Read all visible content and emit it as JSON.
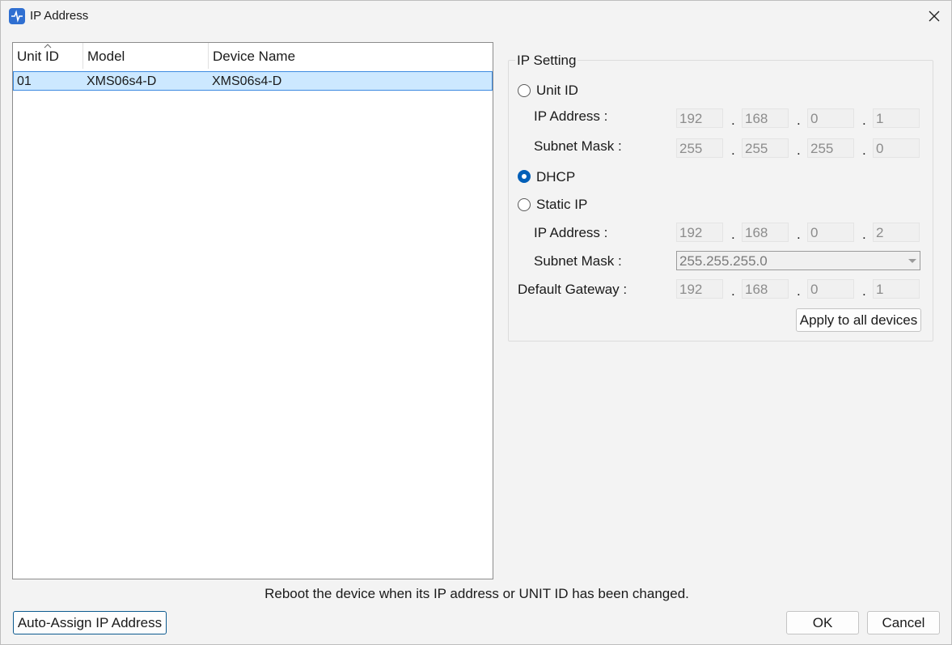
{
  "window": {
    "title": "IP Address"
  },
  "device_list": {
    "columns": [
      "Unit ID",
      "Model",
      "Device Name"
    ],
    "rows": [
      {
        "unit_id": "01",
        "model": "XMS06s4-D",
        "device_name": "XMS06s4-D"
      }
    ]
  },
  "ip_setting": {
    "group_title": "IP Setting",
    "unit_id": {
      "label": "Unit ID",
      "ip_label": "IP Address :",
      "ip": [
        "192",
        "168",
        "0",
        "1"
      ],
      "mask_label": "Subnet Mask :",
      "mask": [
        "255",
        "255",
        "255",
        "0"
      ]
    },
    "dhcp": {
      "label": "DHCP"
    },
    "static": {
      "label": "Static IP",
      "ip_label": "IP Address :",
      "ip": [
        "192",
        "168",
        "0",
        "2"
      ],
      "mask_label": "Subnet Mask :",
      "mask_value": "255.255.255.0"
    },
    "gateway": {
      "label": "Default Gateway :",
      "ip": [
        "192",
        "168",
        "0",
        "1"
      ]
    },
    "selected_mode": "dhcp",
    "apply_label": "Apply to all devices"
  },
  "footer": {
    "notice": "Reboot the device when its IP address or UNIT ID has been changed.",
    "auto_assign_label": "Auto-Assign IP Address",
    "ok_label": "OK",
    "cancel_label": "Cancel"
  },
  "colors": {
    "accent": "#005fb8",
    "selection": "#cce8ff",
    "app_icon": "#2f6fd1"
  }
}
